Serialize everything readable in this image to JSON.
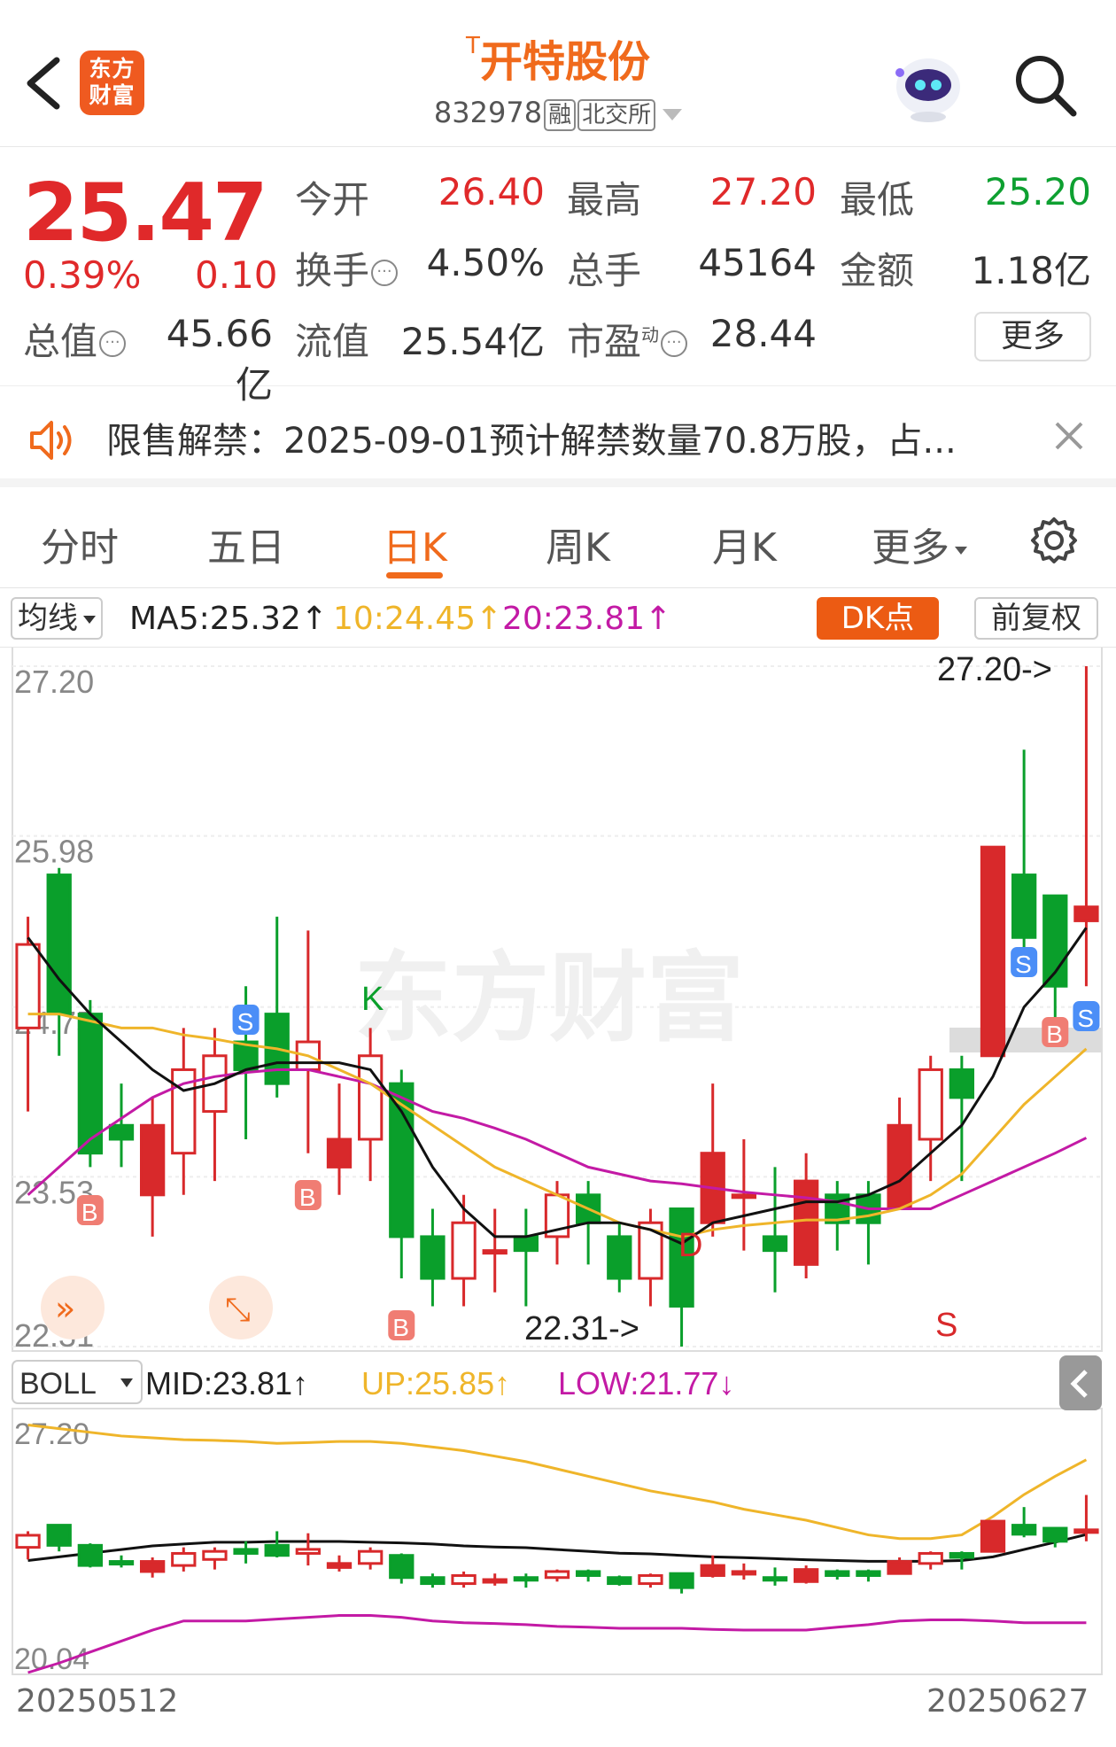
{
  "header": {
    "title_prefix": "T",
    "title": "开特股份",
    "code": "832978",
    "tag1": "融",
    "tag2": "北交所",
    "logo": "东方\n财富"
  },
  "quote": {
    "price": "25.47",
    "change_pct": "0.39%",
    "change": "0.10",
    "labels": {
      "open": "今开",
      "high": "最高",
      "low": "最低",
      "turnover": "换手",
      "volume": "总手",
      "amount": "金额",
      "mktcap": "总值",
      "float": "流值",
      "pe": "市盈",
      "pe_sup": "动"
    },
    "values": {
      "open": "26.40",
      "high": "27.20",
      "low": "25.20",
      "turnover": "4.50%",
      "volume": "45164",
      "amount": "1.18亿",
      "mktcap": "45.66亿",
      "float": "25.54亿",
      "pe": "28.44"
    },
    "more": "更多"
  },
  "notice": {
    "text": "限售解禁：2025-09-01预计解禁数量70.8万股，占..."
  },
  "tabs": [
    "分时",
    "五日",
    "日K",
    "周K",
    "月K",
    "更多"
  ],
  "active_tab": 2,
  "ma_row": {
    "selector": "均线",
    "ma5": "MA5:25.32↑",
    "ma10": "10:24.45↑",
    "ma20": "20:23.81↑",
    "dk": "DK点",
    "adjust": "前复权"
  },
  "boll_row": {
    "selector": "BOLL",
    "mid": "MID:23.81↑",
    "up": "UP:25.85↑",
    "low": "LOW:21.77↓"
  },
  "colors": {
    "up": "#d8292b",
    "down": "#0a9f2b",
    "ma5": "#111111",
    "ma10": "#efb52a",
    "ma20": "#c31aa5",
    "accent": "#f06a1c"
  },
  "chart_data": [
    {
      "type": "candlestick",
      "title": "日K",
      "y_ticks": [
        "27.20",
        "25.98",
        "24.75",
        "23.53",
        "22.31"
      ],
      "ylim": [
        22.31,
        27.2
      ],
      "annotations": {
        "high_marker": "27.20->",
        "low_marker": "22.31->",
        "letter_K": "K",
        "letter_D": "D",
        "letter_S": "S"
      },
      "candles": [
        {
          "o": 24.6,
          "c": 25.2,
          "h": 25.4,
          "l": 24.0
        },
        {
          "o": 25.7,
          "c": 24.7,
          "h": 25.75,
          "l": 24.4
        },
        {
          "o": 24.7,
          "c": 23.7,
          "h": 24.8,
          "l": 23.6
        },
        {
          "o": 23.9,
          "c": 23.8,
          "h": 24.2,
          "l": 23.6
        },
        {
          "o": 23.4,
          "c": 23.9,
          "h": 24.1,
          "l": 23.1
        },
        {
          "o": 23.7,
          "c": 24.3,
          "h": 24.6,
          "l": 23.4
        },
        {
          "o": 24.0,
          "c": 24.4,
          "h": 24.6,
          "l": 23.5
        },
        {
          "o": 24.5,
          "c": 24.3,
          "h": 24.9,
          "l": 23.8
        },
        {
          "o": 24.7,
          "c": 24.2,
          "h": 25.4,
          "l": 24.1
        },
        {
          "o": 24.3,
          "c": 24.5,
          "h": 25.3,
          "l": 23.7
        },
        {
          "o": 23.6,
          "c": 23.8,
          "h": 24.2,
          "l": 23.4
        },
        {
          "o": 23.8,
          "c": 24.4,
          "h": 24.6,
          "l": 23.5
        },
        {
          "o": 24.2,
          "c": 23.1,
          "h": 24.3,
          "l": 22.8
        },
        {
          "o": 23.1,
          "c": 22.8,
          "h": 23.3,
          "l": 22.6
        },
        {
          "o": 22.8,
          "c": 23.2,
          "h": 23.4,
          "l": 22.6
        },
        {
          "o": 23.0,
          "c": 23.0,
          "h": 23.3,
          "l": 22.7
        },
        {
          "o": 23.1,
          "c": 23.0,
          "h": 23.3,
          "l": 22.6
        },
        {
          "o": 23.1,
          "c": 23.4,
          "h": 23.5,
          "l": 22.9
        },
        {
          "o": 23.4,
          "c": 23.2,
          "h": 23.5,
          "l": 22.9
        },
        {
          "o": 23.1,
          "c": 22.8,
          "h": 23.2,
          "l": 22.7
        },
        {
          "o": 22.8,
          "c": 23.2,
          "h": 23.3,
          "l": 22.6
        },
        {
          "o": 23.3,
          "c": 22.6,
          "h": 23.3,
          "l": 22.31
        },
        {
          "o": 23.2,
          "c": 23.7,
          "h": 24.2,
          "l": 23.1
        },
        {
          "o": 23.4,
          "c": 23.4,
          "h": 23.8,
          "l": 23.0
        },
        {
          "o": 23.1,
          "c": 23.0,
          "h": 23.6,
          "l": 22.7
        },
        {
          "o": 22.9,
          "c": 23.5,
          "h": 23.7,
          "l": 22.8
        },
        {
          "o": 23.4,
          "c": 23.2,
          "h": 23.5,
          "l": 23.0
        },
        {
          "o": 23.4,
          "c": 23.2,
          "h": 23.5,
          "l": 22.9
        },
        {
          "o": 23.3,
          "c": 23.9,
          "h": 24.1,
          "l": 23.3
        },
        {
          "o": 23.8,
          "c": 24.3,
          "h": 24.4,
          "l": 23.5
        },
        {
          "o": 24.3,
          "c": 24.1,
          "h": 24.4,
          "l": 23.5
        },
        {
          "o": 24.4,
          "c": 25.9,
          "h": 25.9,
          "l": 24.4
        },
        {
          "o": 25.7,
          "c": 25.25,
          "h": 26.6,
          "l": 25.1
        },
        {
          "o": 25.55,
          "c": 24.9,
          "h": 25.55,
          "l": 24.6
        },
        {
          "o": 25.37,
          "c": 25.47,
          "h": 27.2,
          "l": 24.9
        }
      ],
      "ma5": [
        25.25,
        24.95,
        24.7,
        24.5,
        24.3,
        24.15,
        24.2,
        24.3,
        24.35,
        24.35,
        24.35,
        24.3,
        24.0,
        23.6,
        23.3,
        23.1,
        23.1,
        23.15,
        23.2,
        23.2,
        23.15,
        23.05,
        23.2,
        23.25,
        23.3,
        23.35,
        23.35,
        23.4,
        23.5,
        23.7,
        23.9,
        24.25,
        24.75,
        25.0,
        25.32
      ],
      "ma10": [
        24.7,
        24.7,
        24.65,
        24.6,
        24.6,
        24.55,
        24.52,
        24.48,
        24.45,
        24.4,
        24.3,
        24.2,
        24.05,
        23.9,
        23.75,
        23.6,
        23.5,
        23.4,
        23.3,
        23.2,
        23.15,
        23.1,
        23.15,
        23.18,
        23.2,
        23.22,
        23.22,
        23.25,
        23.3,
        23.4,
        23.55,
        23.8,
        24.05,
        24.25,
        24.45
      ],
      "ma20": [
        23.4,
        23.6,
        23.8,
        23.95,
        24.1,
        24.2,
        24.25,
        24.28,
        24.3,
        24.3,
        24.25,
        24.2,
        24.1,
        24.0,
        23.95,
        23.88,
        23.8,
        23.7,
        23.6,
        23.55,
        23.5,
        23.48,
        23.45,
        23.42,
        23.4,
        23.38,
        23.35,
        23.3,
        23.3,
        23.3,
        23.4,
        23.5,
        23.6,
        23.7,
        23.81
      ]
    },
    {
      "type": "candlestick",
      "title": "BOLL",
      "y_ticks": [
        "27.20",
        "20.04"
      ],
      "ylim": [
        20.04,
        27.2
      ],
      "mid": [
        23.1,
        23.2,
        23.3,
        23.4,
        23.5,
        23.55,
        23.6,
        23.6,
        23.62,
        23.62,
        23.62,
        23.6,
        23.58,
        23.55,
        23.5,
        23.47,
        23.45,
        23.4,
        23.35,
        23.3,
        23.28,
        23.24,
        23.2,
        23.18,
        23.15,
        23.12,
        23.1,
        23.08,
        23.08,
        23.08,
        23.1,
        23.2,
        23.4,
        23.6,
        23.81
      ],
      "up": [
        26.8,
        26.7,
        26.6,
        26.5,
        26.45,
        26.4,
        26.38,
        26.35,
        26.3,
        26.32,
        26.35,
        26.35,
        26.3,
        26.2,
        26.1,
        25.95,
        25.8,
        25.6,
        25.4,
        25.2,
        25.0,
        24.85,
        24.7,
        24.5,
        24.35,
        24.2,
        24.0,
        23.8,
        23.7,
        23.7,
        23.8,
        24.3,
        24.9,
        25.4,
        25.85
      ],
      "low": [
        20.04,
        20.3,
        20.6,
        20.9,
        21.2,
        21.45,
        21.45,
        21.45,
        21.5,
        21.55,
        21.6,
        21.6,
        21.55,
        21.45,
        21.4,
        21.38,
        21.35,
        21.3,
        21.28,
        21.25,
        21.25,
        21.25,
        21.22,
        21.2,
        21.2,
        21.2,
        21.28,
        21.35,
        21.45,
        21.48,
        21.48,
        21.45,
        21.4,
        21.4,
        21.4
      ]
    }
  ],
  "dates": {
    "start": "20250512",
    "end": "20250627"
  },
  "watermark": "东方财富"
}
